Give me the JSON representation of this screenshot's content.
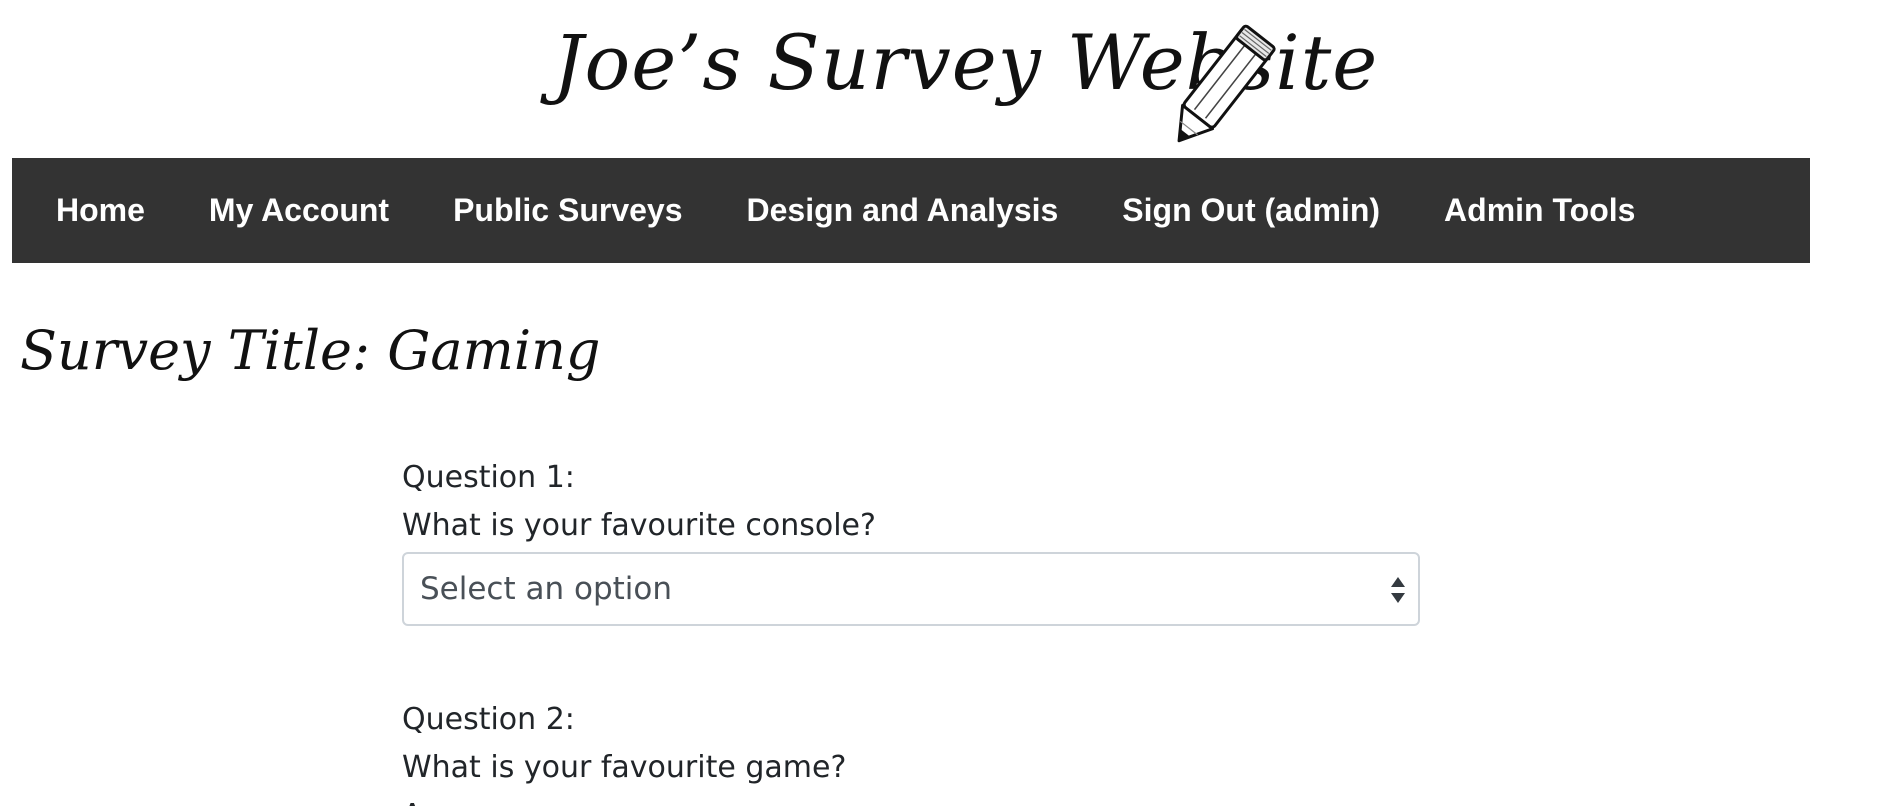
{
  "header": {
    "logo_text": "Joe’s Survey Website",
    "logo_icon": "pencil-icon"
  },
  "nav": {
    "items": [
      {
        "label": "Home"
      },
      {
        "label": "My Account"
      },
      {
        "label": "Public Surveys"
      },
      {
        "label": "Design and Analysis"
      },
      {
        "label": "Sign Out (admin)"
      },
      {
        "label": "Admin Tools"
      }
    ]
  },
  "survey": {
    "title": "Survey Title: Gaming",
    "questions": [
      {
        "number_label": "Question 1:",
        "text": "What is your favourite console?",
        "select_value": "Select an option"
      },
      {
        "number_label": "Question 2:",
        "text": "What is your favourite game?",
        "answer_label": "Answer:"
      }
    ]
  },
  "colors": {
    "navbar_bg": "#333333",
    "nav_text": "#ffffff",
    "select_border": "#ced4da"
  }
}
